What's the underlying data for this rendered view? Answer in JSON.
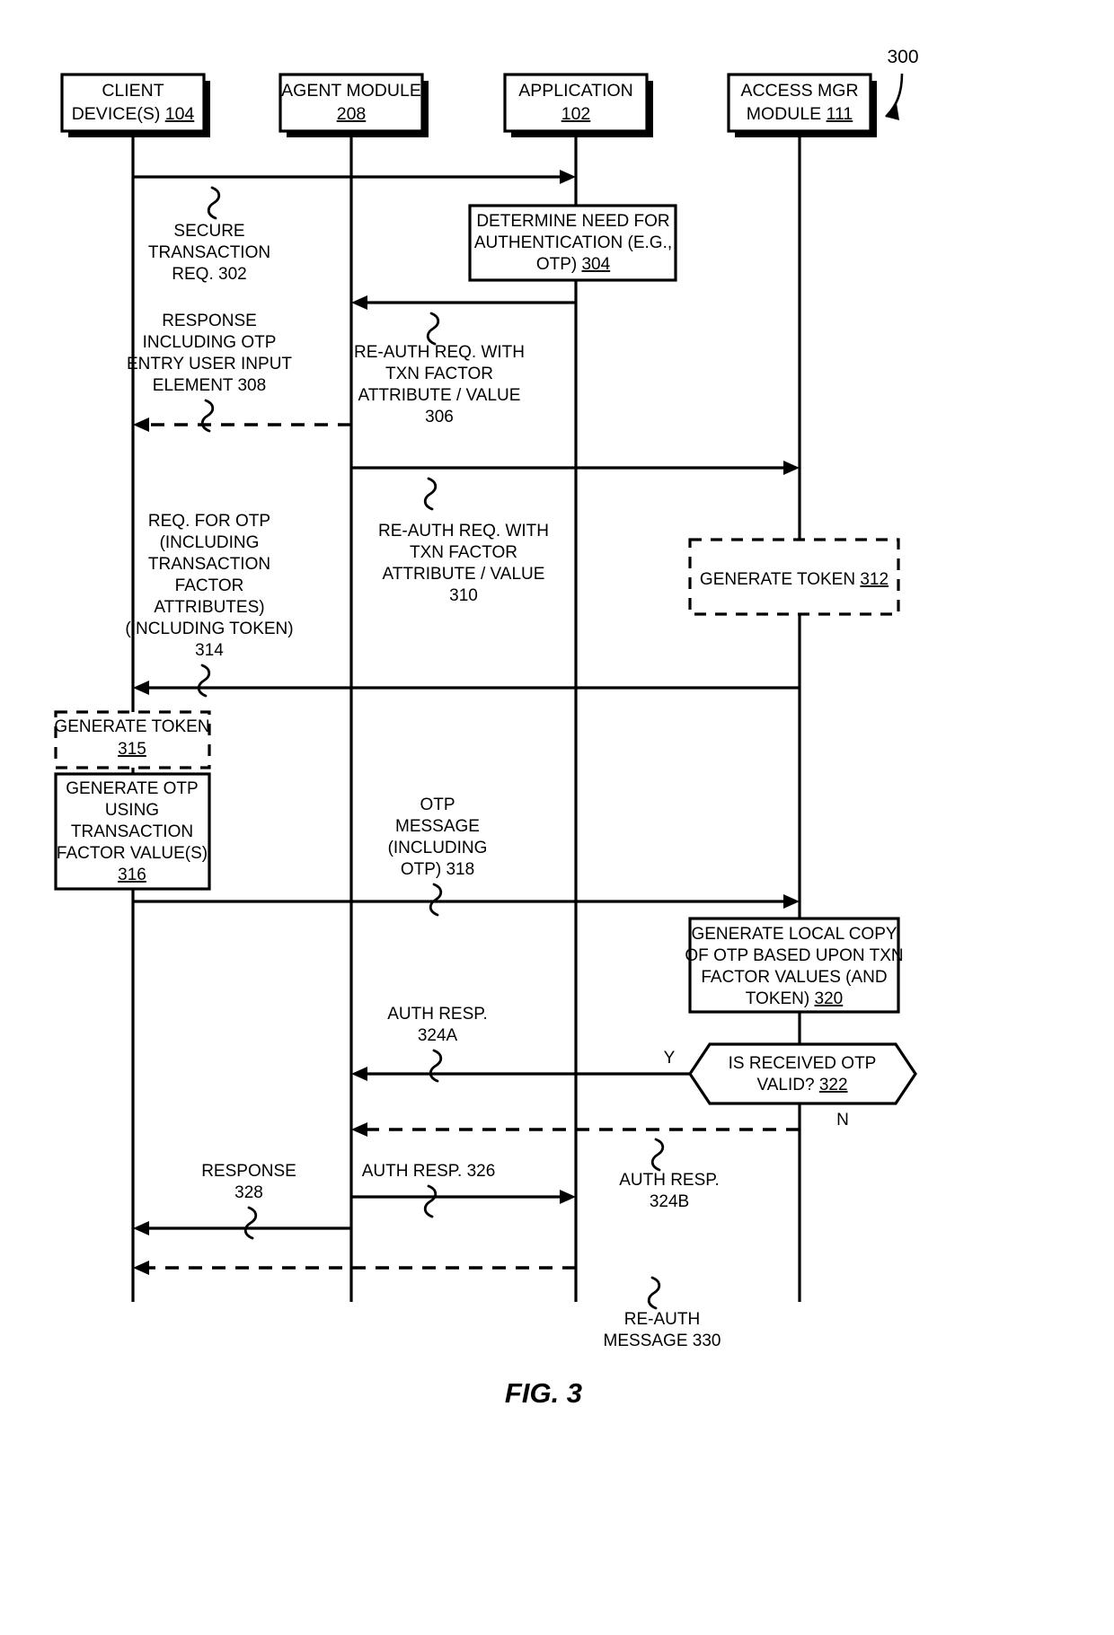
{
  "figure": {
    "caption": "FIG. 3",
    "reference_numeral": "300"
  },
  "lifelines": [
    {
      "id": "client",
      "name": "client-device-lifeline",
      "line1": "CLIENT",
      "line2": "DEVICE(S) ",
      "ref": "104"
    },
    {
      "id": "agent",
      "name": "agent-module-lifeline",
      "line1": "AGENT MODULE",
      "line2": "",
      "ref": "208"
    },
    {
      "id": "application",
      "name": "application-lifeline",
      "line1": "APPLICATION",
      "line2": "",
      "ref": "102"
    },
    {
      "id": "accessmgr",
      "name": "access-manager-lifeline",
      "line1": "ACCESS MGR",
      "line2": "MODULE ",
      "ref": "111"
    }
  ],
  "messages": [
    {
      "id": "m302",
      "name": "secure-transaction-request",
      "style": "solid",
      "lines": [
        "SECURE",
        "TRANSACTION",
        "REQ. 302"
      ]
    },
    {
      "id": "m306",
      "name": "reauth-request-306",
      "style": "solid",
      "lines": [
        "RE-AUTH REQ. WITH",
        "TXN FACTOR",
        "ATTRIBUTE / VALUE",
        "306"
      ]
    },
    {
      "id": "m308",
      "name": "response-including-otp-entry-308",
      "style": "dashed",
      "lines": [
        "RESPONSE",
        "INCLUDING OTP",
        "ENTRY USER INPUT",
        "ELEMENT 308"
      ]
    },
    {
      "id": "m310",
      "name": "reauth-request-310",
      "style": "solid",
      "lines": [
        "RE-AUTH REQ. WITH",
        "TXN FACTOR",
        "ATTRIBUTE / VALUE",
        "310"
      ]
    },
    {
      "id": "m314",
      "name": "request-for-otp-314",
      "style": "solid",
      "lines": [
        "REQ. FOR OTP",
        "(INCLUDING",
        "TRANSACTION",
        "FACTOR",
        "ATTRIBUTES)",
        "(INCLUDING TOKEN)",
        "314"
      ]
    },
    {
      "id": "m318",
      "name": "otp-message-318",
      "style": "solid",
      "lines": [
        "OTP",
        "MESSAGE",
        "(INCLUDING",
        "OTP) 318"
      ]
    },
    {
      "id": "m324a",
      "name": "auth-response-324a",
      "style": "solid",
      "lines": [
        "AUTH RESP.",
        "324A"
      ]
    },
    {
      "id": "m324b",
      "name": "auth-response-324b",
      "style": "dashed",
      "lines": [
        "AUTH RESP.",
        "324B"
      ]
    },
    {
      "id": "m326",
      "name": "auth-response-326",
      "style": "solid",
      "lines": [
        "AUTH RESP. 326"
      ]
    },
    {
      "id": "m328",
      "name": "response-328",
      "style": "solid",
      "lines": [
        "RESPONSE",
        "328"
      ]
    },
    {
      "id": "m330",
      "name": "reauth-message-330",
      "style": "dashed",
      "lines": [
        "RE-AUTH",
        "MESSAGE 330"
      ]
    }
  ],
  "process_boxes": [
    {
      "id": "p304",
      "name": "determine-need-for-authentication-box",
      "border": "solid",
      "lines": [
        "DETERMINE NEED FOR",
        "AUTHENTICATION (E.G.,",
        "OTP) "
      ],
      "ref": "304"
    },
    {
      "id": "p312",
      "name": "generate-token-312-box",
      "border": "dashed",
      "lines": [
        "GENERATE TOKEN "
      ],
      "ref": "312"
    },
    {
      "id": "p315",
      "name": "generate-token-315-box",
      "border": "dashed",
      "lines": [
        "GENERATE TOKEN"
      ],
      "ref": "315"
    },
    {
      "id": "p316",
      "name": "generate-otp-box",
      "border": "solid",
      "lines": [
        "GENERATE OTP",
        "USING",
        "TRANSACTION",
        "FACTOR VALUE(S)"
      ],
      "ref": "316"
    },
    {
      "id": "p320",
      "name": "generate-local-copy-of-otp-box",
      "border": "solid",
      "lines": [
        "GENERATE LOCAL COPY",
        "OF OTP BASED UPON TXN",
        "FACTOR VALUES (AND",
        "TOKEN) "
      ],
      "ref": "320"
    }
  ],
  "decision": {
    "id": "d322",
    "name": "is-received-otp-valid-decision",
    "lines": [
      "IS RECEIVED OTP",
      "VALID? "
    ],
    "ref": "322",
    "yes_label": "Y",
    "no_label": "N"
  },
  "colors": {
    "stroke": "#000000",
    "fill": "#ffffff"
  }
}
